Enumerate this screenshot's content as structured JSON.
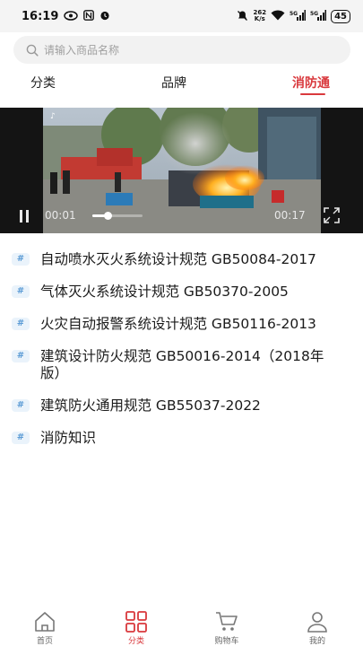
{
  "status_bar": {
    "time": "16:19",
    "left_icons": [
      "eye-icon",
      "nfc-icon",
      "alarm-icon"
    ],
    "right_icons": [
      "mute-icon",
      "network-speed",
      "wifi-icon",
      "signal-5g-icon",
      "signal-5g-icon"
    ],
    "speed_top": "262",
    "speed_bottom": "K/s",
    "battery": "45"
  },
  "search": {
    "placeholder": "请输入商品名称"
  },
  "tabs": [
    {
      "label": "分类",
      "active": false
    },
    {
      "label": "品牌",
      "active": false
    },
    {
      "label": "消防通",
      "active": true
    }
  ],
  "video": {
    "current_time": "00:01",
    "duration": "00:17",
    "progress": 0.3
  },
  "list": [
    {
      "icon": "#",
      "title": "自动喷水灭火系统设计规范 GB50084-2017"
    },
    {
      "icon": "#",
      "title": "气体灭火系统设计规范 GB50370-2005"
    },
    {
      "icon": "#",
      "title": "火灾自动报警系统设计规范 GB50116-2013"
    },
    {
      "icon": "#",
      "title": "建筑设计防火规范 GB50016-2014（2018年版）"
    },
    {
      "icon": "#",
      "title": "建筑防火通用规范 GB55037-2022"
    },
    {
      "icon": "#",
      "title": "消防知识"
    }
  ],
  "bottom_nav": [
    {
      "label": "首页",
      "icon": "home-icon",
      "active": false
    },
    {
      "label": "分类",
      "icon": "category-icon",
      "active": true
    },
    {
      "label": "购物车",
      "icon": "cart-icon",
      "active": false
    },
    {
      "label": "我的",
      "icon": "user-icon",
      "active": false
    }
  ],
  "colors": {
    "accent": "#d9393d",
    "tag_bg": "#eaf3fb",
    "tag_fg": "#5b9bd5"
  }
}
